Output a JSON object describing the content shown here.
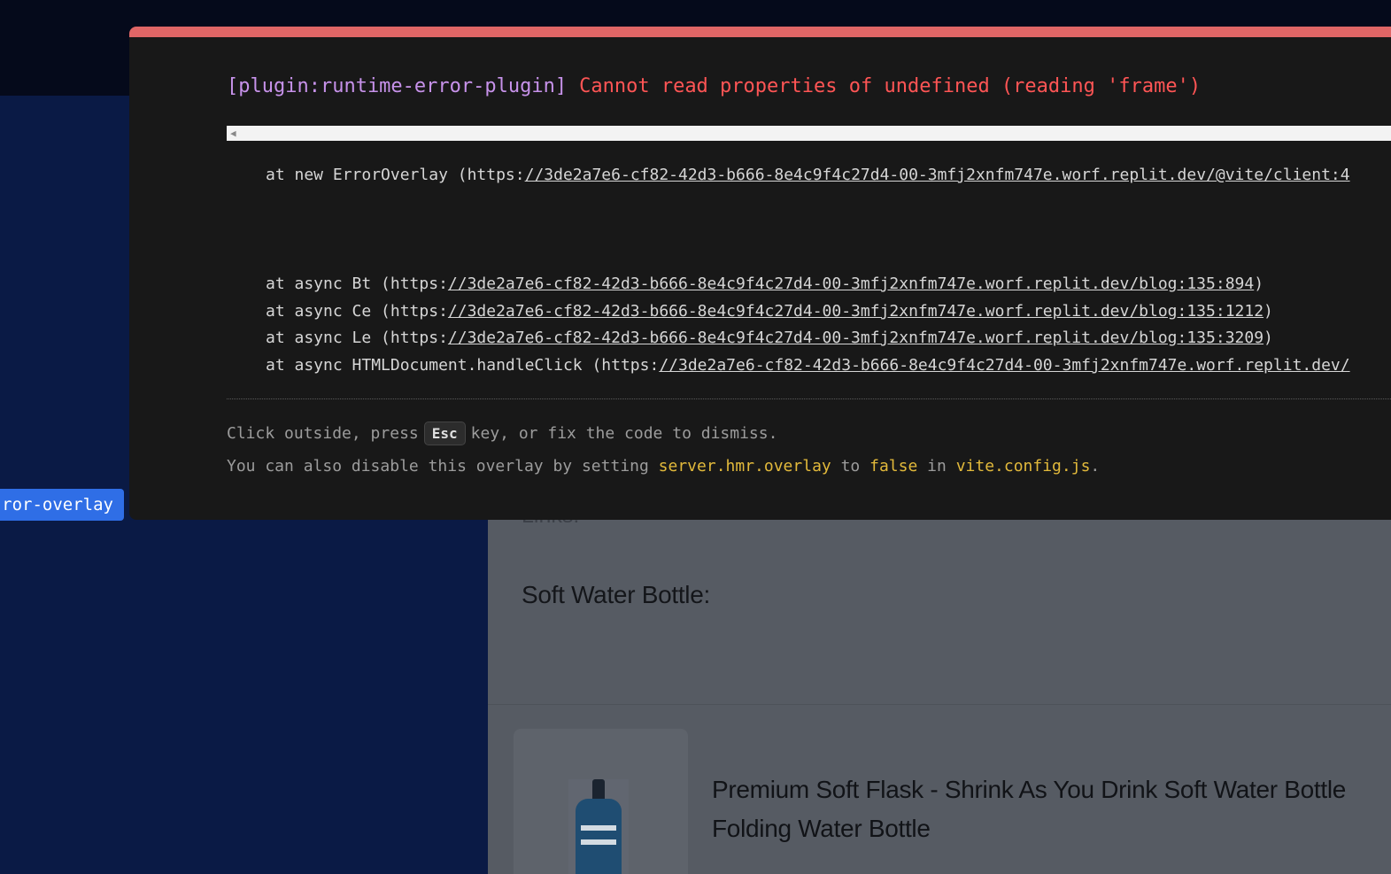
{
  "error_overlay": {
    "plugin": "[plugin:runtime-error-plugin]",
    "message": "Cannot read properties of undefined (reading 'frame')",
    "stack": [
      {
        "prefix": "at new ErrorOverlay (https:",
        "link": "//3de2a7e6-cf82-42d3-b666-8e4c9f4c27d4-00-3mfj2xnfm747e.worf.replit.dev/@vite/client:4",
        "suffix": ""
      },
      {
        "prefix": "at async Bt (https:",
        "link": "//3de2a7e6-cf82-42d3-b666-8e4c9f4c27d4-00-3mfj2xnfm747e.worf.replit.dev/blog:135:894",
        "suffix": ")"
      },
      {
        "prefix": "at async Ce (https:",
        "link": "//3de2a7e6-cf82-42d3-b666-8e4c9f4c27d4-00-3mfj2xnfm747e.worf.replit.dev/blog:135:1212",
        "suffix": ")"
      },
      {
        "prefix": "at async Le (https:",
        "link": "//3de2a7e6-cf82-42d3-b666-8e4c9f4c27d4-00-3mfj2xnfm747e.worf.replit.dev/blog:135:3209",
        "suffix": ")"
      },
      {
        "prefix": "at async HTMLDocument.handleClick (https:",
        "link": "//3de2a7e6-cf82-42d3-b666-8e4c9f4c27d4-00-3mfj2xnfm747e.worf.replit.dev/",
        "suffix": ""
      }
    ],
    "tip1": {
      "before": "Click outside, press",
      "key": "Esc",
      "after": "key, or fix the code to dismiss."
    },
    "tip2": {
      "before": "You can also disable this overlay by setting",
      "setting": "server.hmr.overlay",
      "to": "to",
      "value": "false",
      "in": "in",
      "file": "vite.config.js",
      "end": "."
    },
    "accent_color": "#e06666"
  },
  "overlay_tag": {
    "label": "ror-overlay"
  },
  "page": {
    "links_heading": "Links:",
    "product_heading": "Soft Water Bottle:",
    "product_title": "Premium Soft Flask - Shrink As You Drink Soft Water Bottle Folding Water Bottle"
  }
}
